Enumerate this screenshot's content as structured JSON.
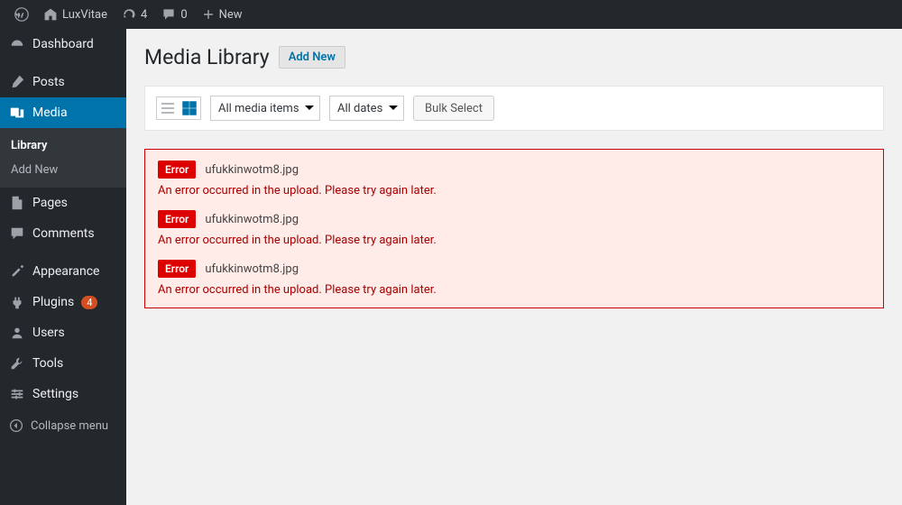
{
  "adminbar": {
    "site_name": "LuxVitae",
    "updates_count": "4",
    "comments_count": "0",
    "new_label": "New"
  },
  "sidebar": {
    "dashboard": "Dashboard",
    "posts": "Posts",
    "media": "Media",
    "media_library": "Library",
    "media_addnew": "Add New",
    "pages": "Pages",
    "comments": "Comments",
    "appearance": "Appearance",
    "plugins": "Plugins",
    "plugins_count": "4",
    "users": "Users",
    "tools": "Tools",
    "settings": "Settings",
    "collapse": "Collapse menu"
  },
  "page": {
    "title": "Media Library",
    "addnew": "Add New"
  },
  "toolbar": {
    "filter_type": "All media items",
    "filter_date": "All dates",
    "bulk_select": "Bulk Select"
  },
  "errors": [
    {
      "badge": "Error",
      "file": "ufukkinwotm8.jpg",
      "msg": "An error occurred in the upload. Please try again later."
    },
    {
      "badge": "Error",
      "file": "ufukkinwotm8.jpg",
      "msg": "An error occurred in the upload. Please try again later."
    },
    {
      "badge": "Error",
      "file": "ufukkinwotm8.jpg",
      "msg": "An error occurred in the upload. Please try again later."
    }
  ]
}
